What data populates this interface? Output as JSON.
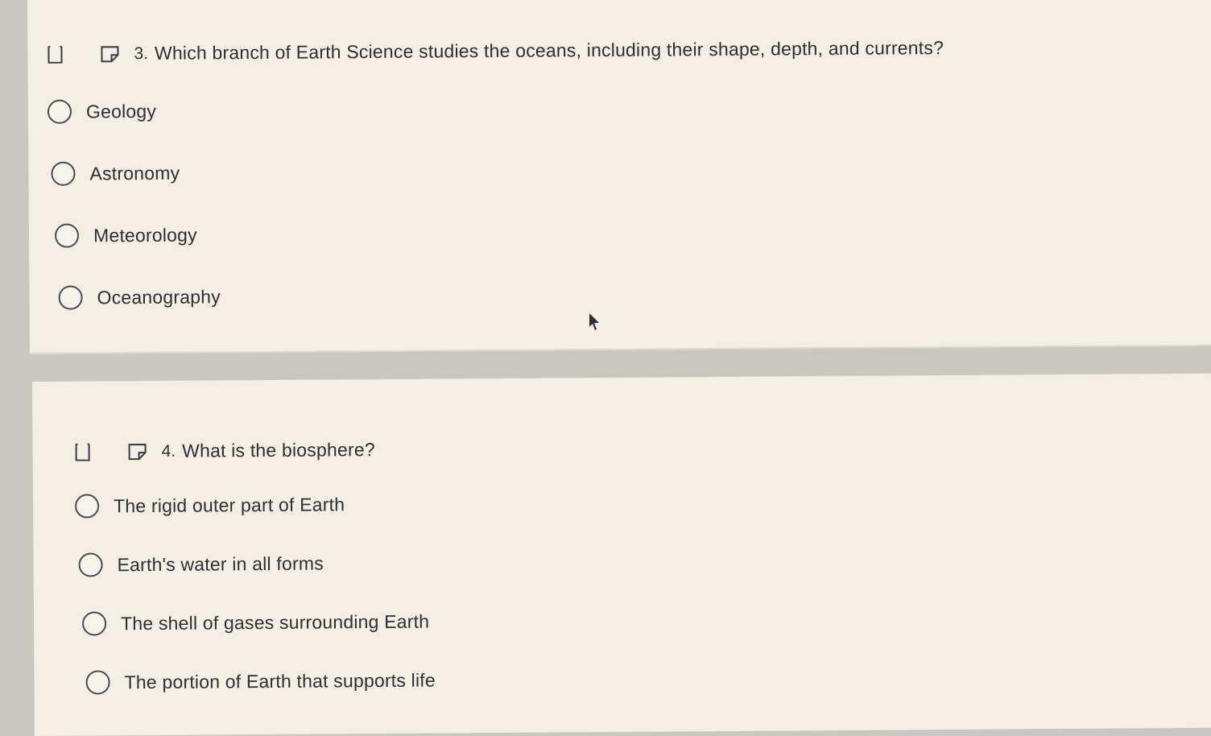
{
  "questions": [
    {
      "number": "3.",
      "text": "Which branch of Earth Science studies the oceans, including their shape, depth, and currents?",
      "options": [
        "Geology",
        "Astronomy",
        "Meteorology",
        "Oceanography"
      ]
    },
    {
      "number": "4.",
      "text": "What is the biosphere?",
      "options": [
        "The rigid outer part of Earth",
        "Earth's water in all forms",
        "The shell of gases surrounding Earth",
        "The portion of Earth that supports life"
      ]
    }
  ],
  "icons": {
    "bookmark": "bookmark-icon",
    "flag": "flag-icon",
    "cursor": "mouse-cursor-icon"
  },
  "colors": {
    "card_background": "#f3efe4",
    "page_background": "#c9c8c0",
    "text": "#2e2e34"
  }
}
